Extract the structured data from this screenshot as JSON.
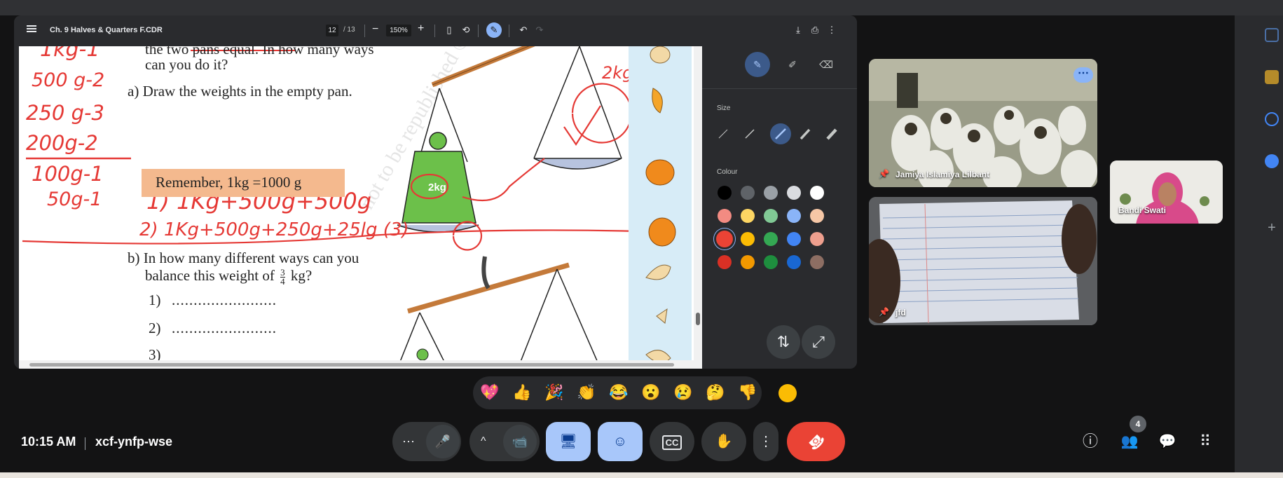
{
  "pdf": {
    "title": "Ch. 9 Halves & Quarters F.CDR",
    "page_current": "12",
    "page_total": "/ 13",
    "zoom": "150%",
    "zoom_minus": "−",
    "zoom_plus": "+"
  },
  "page_content": {
    "line_top": "the two pans equal. In how many ways",
    "line_can": "can you do it?",
    "part_a": "a)  Draw the weights in the empty pan.",
    "remember": "Remember,  1kg =1000 g",
    "part_b_1": "b)  In how many different ways can you",
    "part_b_2": "balance this weight of",
    "frac_num": "3",
    "frac_den": "4",
    "part_b_kg": "kg?",
    "ans1_num": "1)",
    "ans1_dots": "........................",
    "ans2_num": "2)",
    "ans2_dots": "........................",
    "ans3_num": "3)",
    "weight_label": "2kg",
    "watermark": "not to be republished © NCERT"
  },
  "annotations": {
    "left_list": [
      "1kg-1",
      "500 g-2",
      "250 g-3",
      "200g-2",
      "100g-1",
      "50g-1"
    ],
    "way1": "1) 1Kg+500g+500g",
    "way2": "2) 1Kg+500g+250g+25lg (3)",
    "pan_label": "2kg"
  },
  "anno_panel": {
    "size_label": "Size",
    "colour_label": "Colour",
    "colours": [
      "#000000",
      "#5f6368",
      "#9aa0a6",
      "#dadce0",
      "#ffffff",
      "#f28b82",
      "#fdd663",
      "#81c995",
      "#8ab4f8",
      "#f6c7a6",
      "#ea4335",
      "#fbbc04",
      "#34a853",
      "#4285f4",
      "#ee9f8e",
      "#d93025",
      "#f29900",
      "#1e8e3e",
      "#1967d2",
      "#8d6e63"
    ]
  },
  "participants": {
    "tile1_name": "Jamiya Islamiya Lilbant",
    "tile2_name": "jfd",
    "tile3_name": "Bandi Swati",
    "count": "4"
  },
  "reactions": [
    "💖",
    "👍",
    "🎉",
    "👏",
    "😂",
    "😮",
    "😢",
    "🤔",
    "👎"
  ],
  "meeting": {
    "time": "10:15 AM",
    "code": "xcf-ynfp-wse"
  },
  "icons": {
    "more": "⋯",
    "mic": "🎤",
    "chevron": "^",
    "camera": "📹",
    "present": "⬆",
    "emoji": "☺",
    "captions": "CC",
    "hand": "✋",
    "dots_vertical": "⋮",
    "hangup": "☎",
    "info": "ⓘ",
    "people": "👥",
    "chat": "💬",
    "apps": "⠿"
  }
}
